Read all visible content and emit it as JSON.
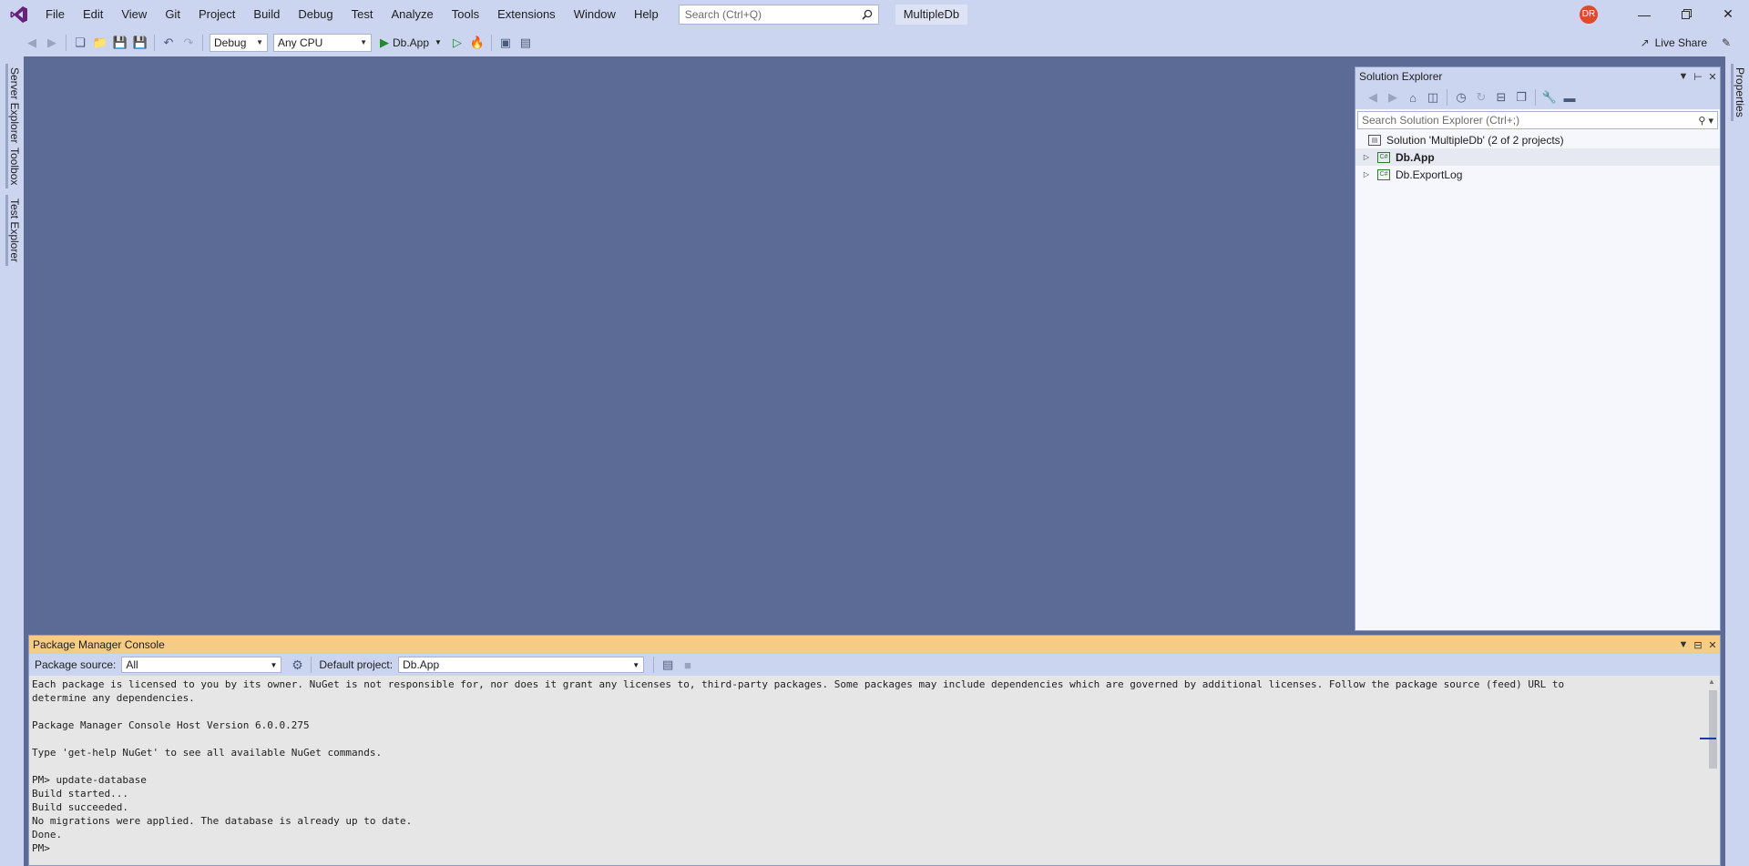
{
  "menu": [
    "File",
    "Edit",
    "View",
    "Git",
    "Project",
    "Build",
    "Debug",
    "Test",
    "Analyze",
    "Tools",
    "Extensions",
    "Window",
    "Help"
  ],
  "search": {
    "placeholder": "Search (Ctrl+Q)"
  },
  "solution_name": "MultipleDb",
  "user": {
    "initials": "DR"
  },
  "toolbar": {
    "config": "Debug",
    "platform": "Any CPU",
    "startup_project": "Db.App",
    "live_share": "Live Share"
  },
  "left_tabs": [
    "Server Explorer",
    "Toolbox",
    "Test Explorer"
  ],
  "right_tabs": [
    "Properties"
  ],
  "solution_explorer": {
    "title": "Solution Explorer",
    "search_placeholder": "Search Solution Explorer (Ctrl+;)",
    "solution_label": "Solution 'MultipleDb' (2 of 2 projects)",
    "projects": [
      {
        "name": "Db.App",
        "bold": true,
        "selected": true
      },
      {
        "name": "Db.ExportLog",
        "bold": false,
        "selected": false
      }
    ]
  },
  "package_manager_console": {
    "title": "Package Manager Console",
    "package_source_label": "Package source:",
    "package_source_value": "All",
    "default_project_label": "Default project:",
    "default_project_value": "Db.App",
    "lines": [
      "Each package is licensed to you by its owner. NuGet is not responsible for, nor does it grant any licenses to, third-party packages. Some packages may include dependencies which are governed by additional licenses. Follow the package source (feed) URL to",
      "determine any dependencies.",
      "",
      "Package Manager Console Host Version 6.0.0.275",
      "",
      "Type 'get-help NuGet' to see all available NuGet commands.",
      "",
      "PM> update-database",
      "Build started...",
      "Build succeeded.",
      "No migrations were applied. The database is already up to date.",
      "Done.",
      "PM>"
    ]
  },
  "colors": {
    "chrome": "#ccd5f0",
    "editor_bg": "#5c6a96",
    "active_panel_title": "#f5cc84",
    "accent_logo": "#68217a"
  }
}
